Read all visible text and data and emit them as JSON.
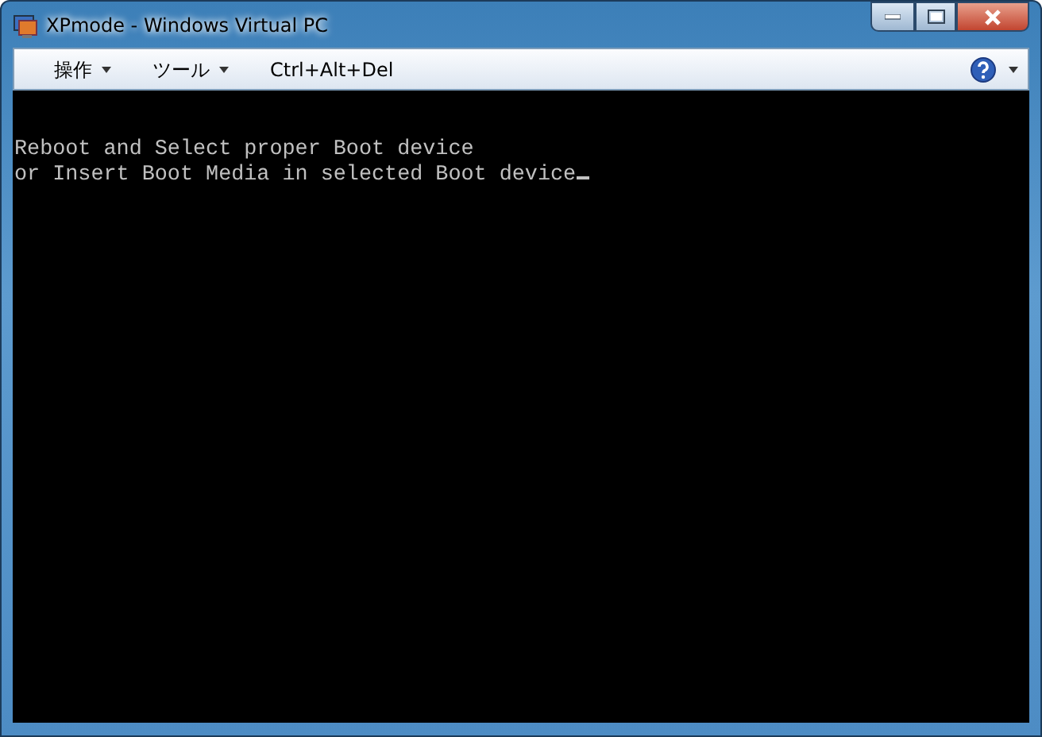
{
  "window": {
    "title": "XPmode - Windows Virtual PC"
  },
  "toolbar": {
    "menus": [
      {
        "label": "操作",
        "kind": "dropdown"
      },
      {
        "label": "ツール",
        "kind": "dropdown"
      },
      {
        "label": "Ctrl+Alt+Del",
        "kind": "button"
      }
    ]
  },
  "console": {
    "lines": [
      "Reboot and Select proper Boot device",
      "or Insert Boot Media in selected Boot device"
    ]
  }
}
